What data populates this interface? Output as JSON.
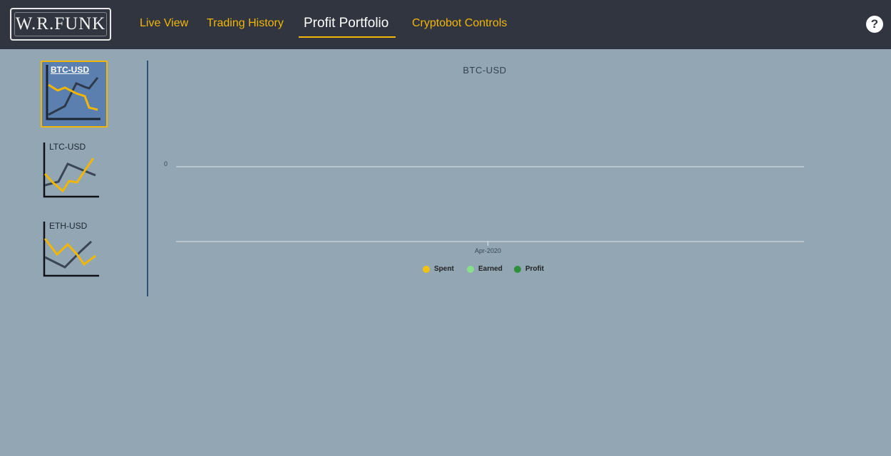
{
  "header": {
    "logo_text": "W.R.FUNK",
    "nav": [
      {
        "label": "Live View",
        "active": false
      },
      {
        "label": "Trading History",
        "active": false
      },
      {
        "label": "Profit Portfolio",
        "active": true
      },
      {
        "label": "Cryptobot Controls",
        "active": false
      }
    ],
    "help_label": "?",
    "accent_color": "#f2b705"
  },
  "sidebar": {
    "items": [
      {
        "label": "BTC-USD",
        "selected": true
      },
      {
        "label": "LTC-USD",
        "selected": false
      },
      {
        "label": "ETH-USD",
        "selected": false
      }
    ]
  },
  "chart_data": {
    "type": "line",
    "title": "BTC-USD",
    "x_ticks": [
      "Apr-2020"
    ],
    "y_ticks": [
      0
    ],
    "series": [
      {
        "name": "Spent",
        "color": "#f2c20d",
        "values": []
      },
      {
        "name": "Earned",
        "color": "#88e08a",
        "values": []
      },
      {
        "name": "Profit",
        "color": "#2f8f3a",
        "values": []
      }
    ],
    "legend_position": "bottom"
  }
}
